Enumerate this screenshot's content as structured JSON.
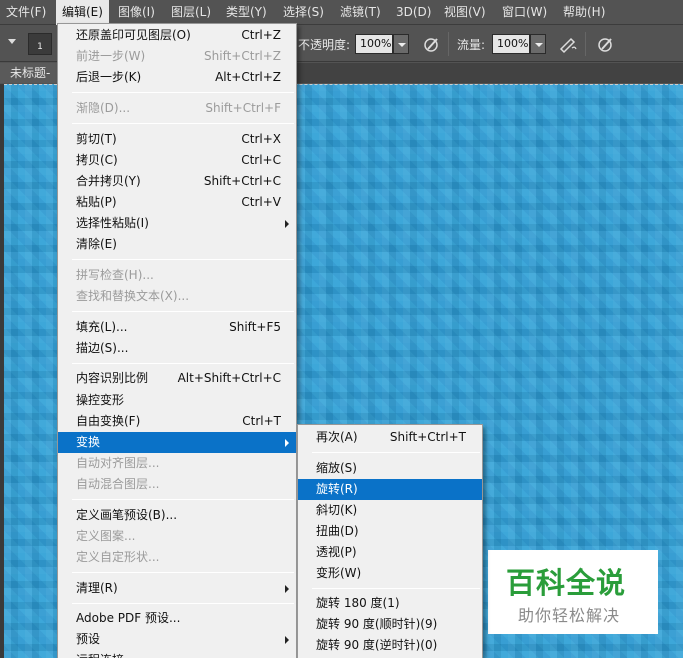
{
  "menubar": {
    "items": [
      {
        "label": "文件(F)"
      },
      {
        "label": "编辑(E)"
      },
      {
        "label": "图像(I)"
      },
      {
        "label": "图层(L)"
      },
      {
        "label": "类型(Y)"
      },
      {
        "label": "选择(S)"
      },
      {
        "label": "滤镜(T)"
      },
      {
        "label": "3D(D)"
      },
      {
        "label": "视图(V)"
      },
      {
        "label": "窗口(W)"
      },
      {
        "label": "帮助(H)"
      }
    ],
    "active_item": "编辑(E)"
  },
  "options_bar": {
    "brush_size": "1",
    "opacity_label": "不透明度:",
    "opacity_value": "100%",
    "flow_label": "流量:",
    "flow_value": "100%"
  },
  "document_tab": {
    "title": "未标题-"
  },
  "edit_menu": {
    "groups": [
      [
        {
          "label": "还原盖印可见图层(O)",
          "shortcut": "Ctrl+Z",
          "disabled": false
        },
        {
          "label": "前进一步(W)",
          "shortcut": "Shift+Ctrl+Z",
          "disabled": true
        },
        {
          "label": "后退一步(K)",
          "shortcut": "Alt+Ctrl+Z",
          "disabled": false
        }
      ],
      [
        {
          "label": "渐隐(D)...",
          "shortcut": "Shift+Ctrl+F",
          "disabled": true
        }
      ],
      [
        {
          "label": "剪切(T)",
          "shortcut": "Ctrl+X",
          "disabled": false
        },
        {
          "label": "拷贝(C)",
          "shortcut": "Ctrl+C",
          "disabled": false
        },
        {
          "label": "合并拷贝(Y)",
          "shortcut": "Shift+Ctrl+C",
          "disabled": false
        },
        {
          "label": "粘贴(P)",
          "shortcut": "Ctrl+V",
          "disabled": false
        },
        {
          "label": "选择性粘贴(I)",
          "shortcut": "",
          "disabled": false,
          "submenu": true
        },
        {
          "label": "清除(E)",
          "shortcut": "",
          "disabled": false
        }
      ],
      [
        {
          "label": "拼写检查(H)...",
          "shortcut": "",
          "disabled": true
        },
        {
          "label": "查找和替换文本(X)...",
          "shortcut": "",
          "disabled": true
        }
      ],
      [
        {
          "label": "填充(L)...",
          "shortcut": "Shift+F5",
          "disabled": false
        },
        {
          "label": "描边(S)...",
          "shortcut": "",
          "disabled": false
        }
      ],
      [
        {
          "label": "内容识别比例",
          "shortcut": "Alt+Shift+Ctrl+C",
          "disabled": false
        },
        {
          "label": "操控变形",
          "shortcut": "",
          "disabled": false
        },
        {
          "label": "自由变换(F)",
          "shortcut": "Ctrl+T",
          "disabled": false
        },
        {
          "label": "变换",
          "shortcut": "",
          "disabled": false,
          "submenu": true,
          "highlighted": true
        },
        {
          "label": "自动对齐图层...",
          "shortcut": "",
          "disabled": true
        },
        {
          "label": "自动混合图层...",
          "shortcut": "",
          "disabled": true
        }
      ],
      [
        {
          "label": "定义画笔预设(B)...",
          "shortcut": "",
          "disabled": false
        },
        {
          "label": "定义图案...",
          "shortcut": "",
          "disabled": true
        },
        {
          "label": "定义自定形状...",
          "shortcut": "",
          "disabled": true
        }
      ],
      [
        {
          "label": "清理(R)",
          "shortcut": "",
          "disabled": false,
          "submenu": true
        }
      ],
      [
        {
          "label": "Adobe PDF 预设...",
          "shortcut": "",
          "disabled": false
        },
        {
          "label": "预设",
          "shortcut": "",
          "disabled": false,
          "submenu": true
        },
        {
          "label": "远程连接...",
          "shortcut": "",
          "disabled": false
        }
      ]
    ]
  },
  "transform_menu": {
    "groups": [
      [
        {
          "label": "再次(A)",
          "shortcut": "Shift+Ctrl+T"
        }
      ],
      [
        {
          "label": "缩放(S)",
          "shortcut": ""
        },
        {
          "label": "旋转(R)",
          "shortcut": "",
          "highlighted": true
        },
        {
          "label": "斜切(K)",
          "shortcut": ""
        },
        {
          "label": "扭曲(D)",
          "shortcut": ""
        },
        {
          "label": "透视(P)",
          "shortcut": ""
        },
        {
          "label": "变形(W)",
          "shortcut": ""
        }
      ],
      [
        {
          "label": "旋转 180 度(1)",
          "shortcut": ""
        },
        {
          "label": "旋转 90 度(顺时针)(9)",
          "shortcut": ""
        },
        {
          "label": "旋转 90 度(逆时针)(0)",
          "shortcut": ""
        }
      ]
    ]
  },
  "watermark": {
    "title": "百科全说",
    "subtitle": "助你轻松解决"
  },
  "colors": {
    "highlight": "#0a72c8",
    "canvas": "#2f9fd6",
    "chrome": "#535353"
  }
}
